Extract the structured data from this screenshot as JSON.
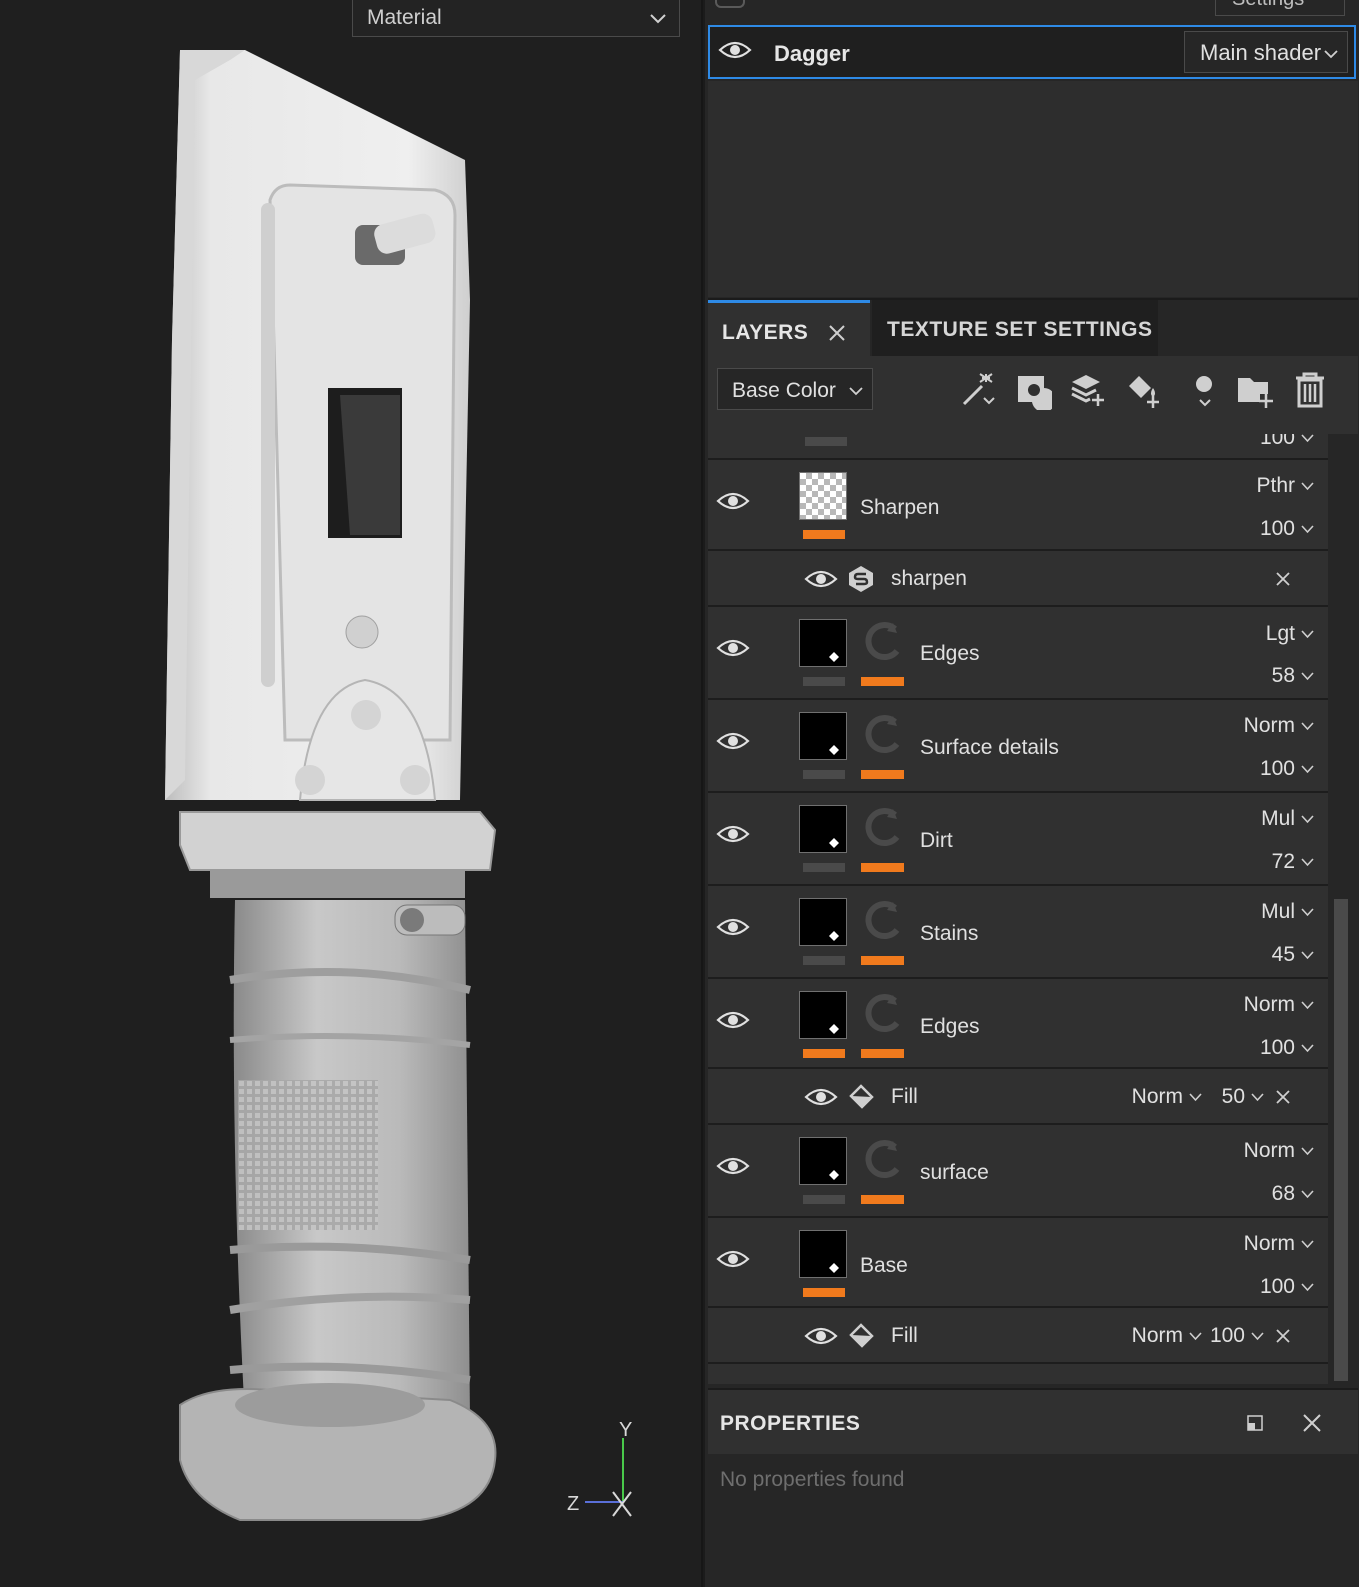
{
  "viewport": {
    "material_mode": "Material",
    "axis_labels": {
      "y": "Y",
      "z": "Z",
      "x": "X"
    }
  },
  "texture_set": {
    "top_settings_label": "Settings",
    "name": "Dagger",
    "shader": "Main shader"
  },
  "tabs": {
    "layers": "LAYERS",
    "texture_set_settings": "TEXTURE SET SETTINGS"
  },
  "toolbar": {
    "channel": "Base Color",
    "icons": [
      "magic-wand-icon",
      "smart-mask-icon",
      "add-layer-icon",
      "add-fill-layer-icon",
      "add-mask-icon",
      "add-folder-icon",
      "delete-icon"
    ]
  },
  "layers": {
    "partial_top_opacity": "100",
    "items": [
      {
        "name": "Sharpen",
        "blend": "Pthr",
        "opacity": "100",
        "sub": {
          "name": "sharpen"
        }
      },
      {
        "name": "Edges",
        "blend": "Lgt",
        "opacity": "58"
      },
      {
        "name": "Surface details",
        "blend": "Norm",
        "opacity": "100"
      },
      {
        "name": "Dirt",
        "blend": "Mul",
        "opacity": "72"
      },
      {
        "name": "Stains",
        "blend": "Mul",
        "opacity": "45"
      },
      {
        "name": "Edges",
        "blend": "Norm",
        "opacity": "100",
        "sub": {
          "name": "Fill",
          "blend": "Norm",
          "opacity": "50"
        }
      },
      {
        "name": "surface",
        "blend": "Norm",
        "opacity": "68"
      },
      {
        "name": "Base",
        "blend": "Norm",
        "opacity": "100",
        "sub": {
          "name": "Fill",
          "blend": "Norm",
          "opacity": "100"
        }
      }
    ]
  },
  "properties": {
    "title": "PROPERTIES",
    "empty_text": "No properties found"
  },
  "colors": {
    "accent": "#2e8ae6",
    "channel_bar": "#f07a1d",
    "panel_bg": "#303030"
  }
}
